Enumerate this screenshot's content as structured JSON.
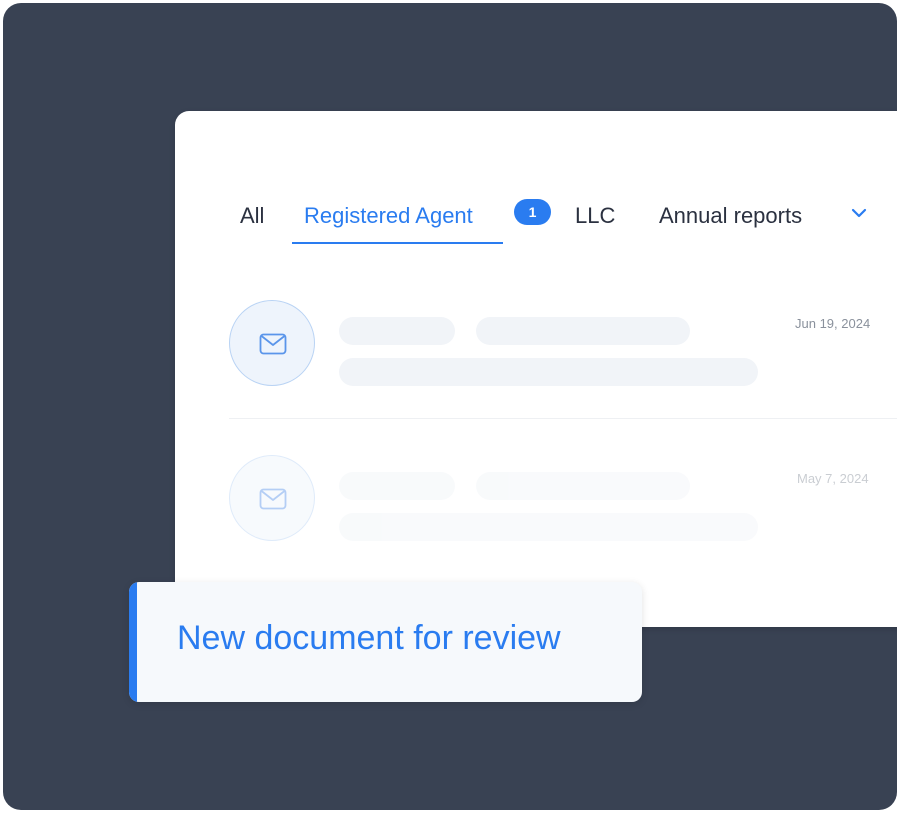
{
  "tabs": {
    "all": "All",
    "registered_agent": "Registered Agent",
    "registered_agent_badge": "1",
    "llc": "LLC",
    "annual_reports": "Annual reports",
    "more_icon": "chevron-down-icon"
  },
  "messages": [
    {
      "date": "Jun 19, 2024",
      "icon": "envelope-icon"
    },
    {
      "date": "May 7, 2024",
      "icon": "envelope-icon"
    }
  ],
  "toast": {
    "text": "New document for review"
  },
  "colors": {
    "background": "#394253",
    "accent": "#2a7cf0",
    "panel": "#ffffff",
    "skeleton": "#f1f4f8"
  }
}
